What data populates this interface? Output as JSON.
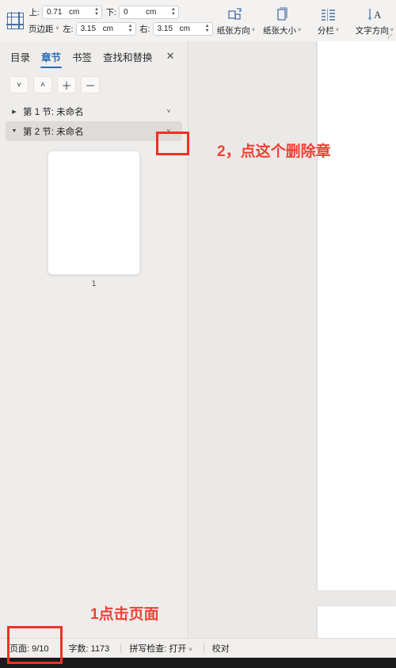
{
  "ribbon": {
    "margins": {
      "icon_name": "page-margins-icon",
      "label": "页边距",
      "caret": "˅",
      "fields": [
        {
          "label": "上:",
          "value": "0.71",
          "unit": "cm",
          "name": "margin-top-field"
        },
        {
          "label": "下:",
          "value": "0",
          "unit": "cm",
          "name": "margin-bottom-field"
        },
        {
          "label": "左:",
          "value": "3.15",
          "unit": "cm",
          "name": "margin-left-field"
        },
        {
          "label": "右:",
          "value": "3.15",
          "unit": "cm",
          "name": "margin-right-field"
        }
      ]
    },
    "buttons": [
      {
        "label": "纸张方向",
        "icon": "page-orientation-icon",
        "caret": "˅",
        "name": "page-orientation-button"
      },
      {
        "label": "纸张大小",
        "icon": "page-size-icon",
        "caret": "˅",
        "name": "page-size-button"
      },
      {
        "label": "分栏",
        "icon": "columns-icon",
        "caret": "˅",
        "name": "columns-button"
      },
      {
        "label": "文字方向",
        "icon": "text-direction-icon",
        "caret": "˅",
        "name": "text-direction-button"
      }
    ],
    "launcher_glyph": "◸"
  },
  "pane": {
    "tabs": [
      {
        "label": "目录",
        "active": false
      },
      {
        "label": "章节",
        "active": true
      },
      {
        "label": "书签",
        "active": false
      },
      {
        "label": "查找和替换",
        "active": false
      }
    ],
    "close_glyph": "✕",
    "mini_tools": [
      {
        "glyph": "˅",
        "name": "move-down-button"
      },
      {
        "glyph": "˄",
        "name": "move-up-button"
      },
      {
        "glyph": "＋",
        "name": "add-section-button"
      },
      {
        "glyph": "－",
        "name": "remove-section-button"
      }
    ],
    "tree": [
      {
        "twisty": "▶",
        "label": "第 1 节: 未命名",
        "chevron": "˅",
        "selected": false
      },
      {
        "twisty": "▼",
        "label": "第 2 节: 未命名",
        "chevron": "˅",
        "selected": true
      }
    ],
    "thumbnail": {
      "page_number": "1"
    }
  },
  "status": {
    "page": "页面: 9/10",
    "words": "字数: 1173",
    "spellcheck": "拼写检查: 打开",
    "spellcheck_caret": "˅",
    "proofread": "校对"
  },
  "annotations": {
    "step2_text": "2，点这个删除章",
    "step1_text": "1点击页面",
    "color": "#ee3124"
  }
}
